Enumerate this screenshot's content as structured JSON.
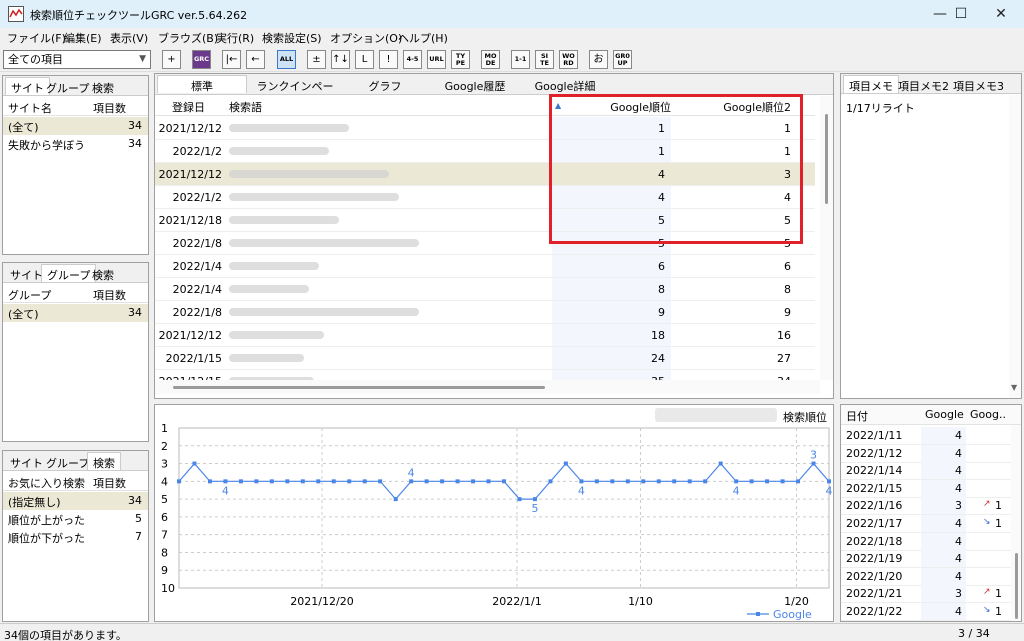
{
  "window": {
    "title": "検索順位チェックツールGRC  ver.5.64.262",
    "minimize": "—",
    "maximize": "☐",
    "close": "✕"
  },
  "menu": [
    "ファイル(F)",
    "編集(E)",
    "表示(V)",
    "ブラウズ(B)",
    "実行(R)",
    "検索設定(S)",
    "オプション(O)",
    "ヘルプ(H)"
  ],
  "toolbar": {
    "select_value": "全ての項目",
    "buttons": [
      "+",
      "GRC",
      "|←",
      "←",
      "ALL",
      "±",
      "↑↓",
      "L",
      "!",
      "4-5",
      "URL",
      "TY PE",
      "MO DE",
      "1-1",
      "SI TE",
      "WO RD",
      "お",
      "GR0 UP"
    ]
  },
  "site_panel": {
    "tabs": [
      "サイト",
      "グループ",
      "検索"
    ],
    "headers": [
      "サイト名",
      "項目数"
    ],
    "rows": [
      {
        "name": "(全て)",
        "count": "34"
      },
      {
        "name": "失敗から学ぼう",
        "count": "34"
      }
    ]
  },
  "group_panel": {
    "tabs": [
      "サイト",
      "グループ",
      "検索"
    ],
    "headers": [
      "グループ",
      "項目数"
    ],
    "rows": [
      {
        "name": "(全て)",
        "count": "34"
      }
    ]
  },
  "search_panel": {
    "tabs": [
      "サイト",
      "グループ",
      "検索"
    ],
    "headers": [
      "お気に入り検索",
      "項目数"
    ],
    "rows": [
      {
        "name": "(指定無し)",
        "count": "34"
      },
      {
        "name": "順位が上がった",
        "count": "5"
      },
      {
        "name": "順位が下がった",
        "count": "7"
      }
    ]
  },
  "main_tabs": [
    "標準",
    "ランクインページ",
    "グラフ",
    "Google履歴",
    "Google詳細"
  ],
  "grid": {
    "headers": [
      "登録日",
      "検索語",
      "Google順位",
      "Google順位2"
    ],
    "rows": [
      {
        "date": "2021/12/12",
        "g": "1",
        "g2": "1"
      },
      {
        "date": "2022/1/2",
        "g": "1",
        "g2": "1"
      },
      {
        "date": "2021/12/12",
        "g": "4",
        "g2": "3"
      },
      {
        "date": "2022/1/2",
        "g": "4",
        "g2": "4"
      },
      {
        "date": "2021/12/18",
        "g": "5",
        "g2": "5"
      },
      {
        "date": "2022/1/8",
        "g": "5",
        "g2": "5"
      },
      {
        "date": "2022/1/4",
        "g": "6",
        "g2": "6"
      },
      {
        "date": "2022/1/4",
        "g": "8",
        "g2": "8"
      },
      {
        "date": "2022/1/8",
        "g": "9",
        "g2": "9"
      },
      {
        "date": "2021/12/12",
        "g": "18",
        "g2": "16"
      },
      {
        "date": "2022/1/15",
        "g": "24",
        "g2": "27"
      },
      {
        "date": "2021/12/15",
        "g": "35",
        "g2": "34"
      }
    ]
  },
  "memo_panel": {
    "tabs": [
      "項目メモ",
      "項目メモ2",
      "項目メモ3"
    ],
    "text": "1/17リライト"
  },
  "chart_data": {
    "type": "line",
    "tab_label": "検索順位",
    "legend": "Google",
    "ylim": [
      1,
      10
    ],
    "y_ticks": [
      "1",
      "2",
      "3",
      "4",
      "5",
      "6",
      "7",
      "8",
      "9",
      "10"
    ],
    "x_ticks": [
      "2021/12/20",
      "2022/1/1",
      "1/10",
      "1/20"
    ],
    "values": [
      4,
      3,
      4,
      4,
      4,
      4,
      4,
      4,
      4,
      4,
      4,
      4,
      4,
      4,
      5,
      4,
      4,
      4,
      4,
      4,
      4,
      4,
      5,
      5,
      4,
      3,
      4,
      4,
      4,
      4,
      4,
      4,
      4,
      4,
      4,
      3,
      4,
      4,
      4,
      4,
      4,
      3,
      4
    ],
    "labels": [
      {
        "index": 3,
        "text": "4"
      },
      {
        "index": 15,
        "text": "4"
      },
      {
        "index": 23,
        "text": "5"
      },
      {
        "index": 26,
        "text": "4"
      },
      {
        "index": 36,
        "text": "4"
      },
      {
        "index": 41,
        "text": "3"
      },
      {
        "index": 42,
        "text": "4"
      }
    ]
  },
  "date_panel": {
    "headers": [
      "日付",
      "Google",
      "Goog.."
    ],
    "rows": [
      {
        "date": "2022/1/11",
        "g": "4",
        "chg": ""
      },
      {
        "date": "2022/1/12",
        "g": "4",
        "chg": ""
      },
      {
        "date": "2022/1/14",
        "g": "4",
        "chg": ""
      },
      {
        "date": "2022/1/15",
        "g": "4",
        "chg": ""
      },
      {
        "date": "2022/1/16",
        "g": "3",
        "chg": "1",
        "dir": "up"
      },
      {
        "date": "2022/1/17",
        "g": "4",
        "chg": "1",
        "dir": "down"
      },
      {
        "date": "2022/1/18",
        "g": "4",
        "chg": ""
      },
      {
        "date": "2022/1/19",
        "g": "4",
        "chg": ""
      },
      {
        "date": "2022/1/20",
        "g": "4",
        "chg": ""
      },
      {
        "date": "2022/1/21",
        "g": "3",
        "chg": "1",
        "dir": "up"
      },
      {
        "date": "2022/1/22",
        "g": "4",
        "chg": "1",
        "dir": "down"
      }
    ]
  },
  "status": {
    "message": "34個の項目があります。",
    "position": "3 / 34"
  },
  "colors": {
    "accent": "#4a86e8",
    "highlight": "#e0202a",
    "selected_row": "#ece8d6",
    "up_arrow": "#d0302a",
    "down_arrow": "#2a6ad0"
  }
}
